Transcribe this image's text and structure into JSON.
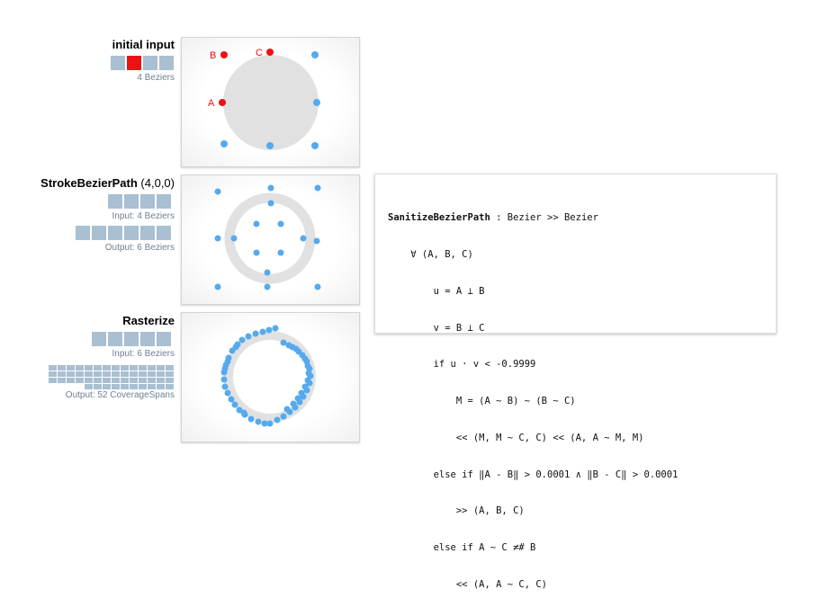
{
  "stages": [
    {
      "title_bold": "initial input",
      "title_rest": "",
      "blocks": [
        false,
        true,
        false,
        false
      ],
      "caption": "4 Beziers"
    },
    {
      "title_bold": "StrokeBezierPath",
      "title_rest": " (4,0,0)",
      "input_blocks": 4,
      "input_caption": "Input:  4 Beziers",
      "output_blocks": 6,
      "output_caption": "Output:  6 Beziers"
    },
    {
      "title_bold": "Rasterize",
      "title_rest": "",
      "input_blocks": 6,
      "input_caption": "Input:  6 Beziers",
      "output_blocks": 52,
      "output_caption": "Output:  52 CoverageSpans"
    }
  ],
  "point_labels": {
    "a": "A",
    "b": "B",
    "c": "C"
  },
  "colors": {
    "point": "#55aaee",
    "highlight": "#ee1111",
    "block": "#a9bfd2",
    "disk": "#e1e1e1"
  },
  "code": {
    "fn_name": "SanitizeBezierPath",
    "signature_rest": " : Bezier >> Bezier",
    "lines": [
      "    ∀ (A, B, C)",
      "        u = A ⊥ B",
      "        v = B ⊥ C",
      "        if u · v < -0.9999",
      "            M = (A ~ B) ~ (B ~ C)",
      "            << (M, M ~ C, C) << (A, A ~ M, M)",
      "        else if ‖A - B‖ > 0.0001 ∧ ‖B - C‖ > 0.0001",
      "            >> (A, B, C)",
      "        else if A ~ C ≠# B",
      "            << (A, A ~ C, C)"
    ]
  }
}
